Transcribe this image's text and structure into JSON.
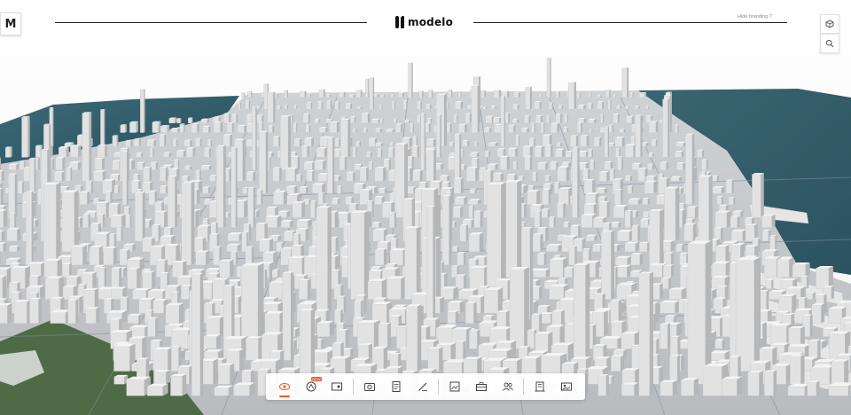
{
  "brand": {
    "wordmark": "modelo",
    "corner_logo_letter": "M"
  },
  "header": {
    "hide_branding_label": "Hide branding ?"
  },
  "toolbar": {
    "tools": [
      {
        "name": "view-icon",
        "active": true
      },
      {
        "name": "beta-feature-icon",
        "badge": "NEW"
      },
      {
        "name": "map-pin-icon"
      },
      {
        "name": "camera-icon"
      },
      {
        "name": "notes-icon"
      },
      {
        "name": "pencil-ruler-icon"
      },
      {
        "name": "image-frame-icon"
      },
      {
        "name": "briefcase-icon"
      },
      {
        "name": "people-icon"
      },
      {
        "name": "building-icon"
      },
      {
        "name": "image-export-icon"
      }
    ]
  },
  "colors": {
    "accent": "#f05a28",
    "water": "#2f5d6b",
    "building": "#dcdcdc",
    "park": "#4f6b45"
  }
}
